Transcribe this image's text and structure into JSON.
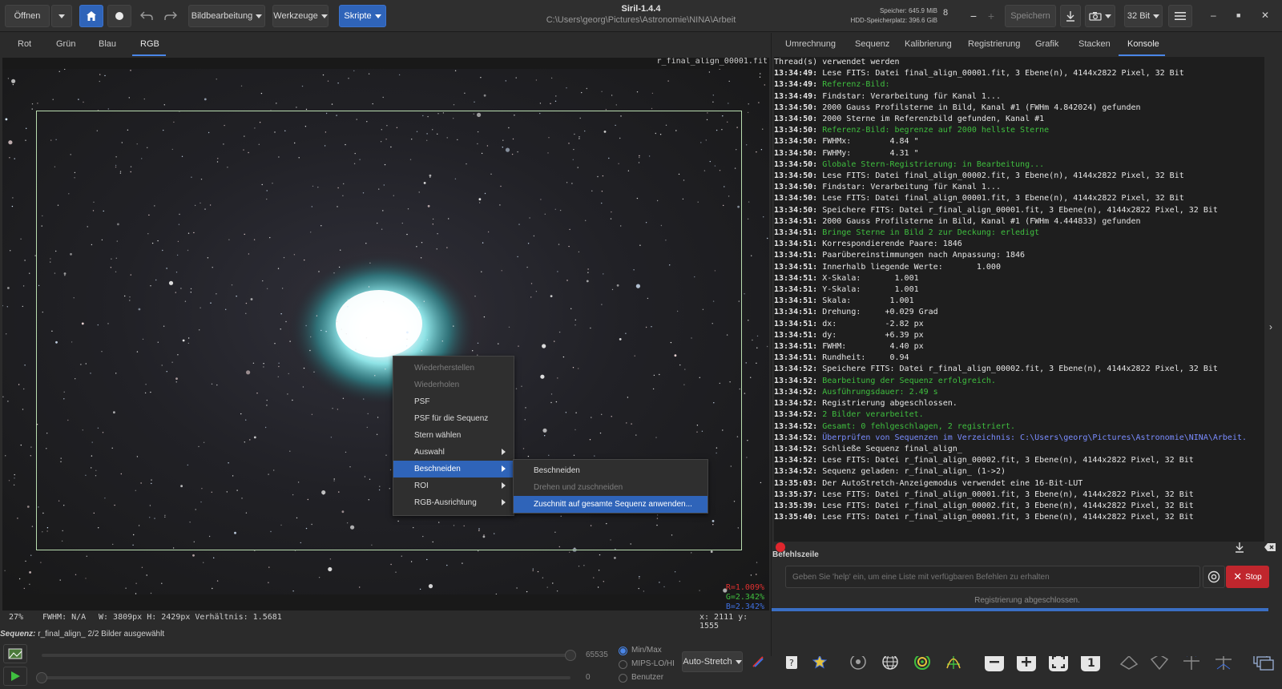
{
  "header": {
    "open_label": "Öffnen",
    "image_processing_label": "Bildbearbeitung",
    "tools_label": "Werkzeuge",
    "scripts_label": "Skripte",
    "app_title": "Siril-1.4.4",
    "app_path": "C:\\Users\\georg\\Pictures\\Astronomie\\NINA\\Arbeit",
    "memory_label": "Speicher: 645.9 MiB",
    "disk_label": "HDD-Speicherplatz: 396.6 GiB",
    "threads_value": "8",
    "save_label": "Speichern",
    "bitdepth_label": "32 Bit"
  },
  "channel_tabs": [
    {
      "label": "Rot"
    },
    {
      "label": "Grün"
    },
    {
      "label": "Blau"
    },
    {
      "label": "RGB"
    }
  ],
  "image": {
    "filename": "r_final_align_00001.fit",
    "stats": {
      "r": "R=1.009%",
      "g": "G=2.342%",
      "b": "B=2.342%"
    },
    "colors": {
      "r": "#e03030",
      "g": "#3fbf3f",
      "b": "#3f6fe0"
    }
  },
  "image_status": {
    "zoom": "27%",
    "fwhm": "FWHM: N/A",
    "dims": "W: 3809px H: 2429px Verhältnis: 1.5681",
    "coords": "x: 2111 y: 1555"
  },
  "sequence_status": {
    "prefix": "Sequenz:",
    "text": "r_final_align_ 2/2 Bilder ausgewählt"
  },
  "bottom": {
    "slider_max_value": "65535",
    "slider_min_value": "0",
    "radio_minmax": "Min/Max",
    "radio_mips": "MIPS-LO/HI",
    "radio_user": "Benutzer",
    "autostretch_label": "Auto-Stretch"
  },
  "right_tabs": [
    {
      "label": "Umrechnung"
    },
    {
      "label": "Sequenz"
    },
    {
      "label": "Kalibrierung"
    },
    {
      "label": "Registrierung"
    },
    {
      "label": "Grafik"
    },
    {
      "label": "Stacken"
    },
    {
      "label": "Konsole"
    }
  ],
  "console": {
    "lines": [
      {
        "t": "",
        "m": "Thread(s) verwendet werden",
        "c": "n"
      },
      {
        "t": "13:34:49:",
        "m": " Lese FITS: Datei final_align_00001.fit, 3 Ebene(n), 4144x2822 Pixel, 32 Bit",
        "c": "n"
      },
      {
        "t": "13:34:49:",
        "m": " Referenz-Bild:",
        "c": "g"
      },
      {
        "t": "13:34:49:",
        "m": " Findstar: Verarbeitung für Kanal 1...",
        "c": "n"
      },
      {
        "t": "13:34:50:",
        "m": " 2000 Gauss Profilsterne in Bild, Kanal #1 (FWHm 4.842024) gefunden",
        "c": "n"
      },
      {
        "t": "13:34:50:",
        "m": " 2000 Sterne im Referenzbild gefunden, Kanal #1",
        "c": "n"
      },
      {
        "t": "13:34:50:",
        "m": " Referenz-Bild: begrenze auf 2000 hellste Sterne",
        "c": "g"
      },
      {
        "t": "13:34:50:",
        "m": " FWHMx:        4.84 \"",
        "c": "n"
      },
      {
        "t": "13:34:50:",
        "m": " FWHMy:        4.31 \"",
        "c": "n"
      },
      {
        "t": "13:34:50:",
        "m": " Globale Stern-Registrierung: in Bearbeitung...",
        "c": "g"
      },
      {
        "t": "13:34:50:",
        "m": " Lese FITS: Datei final_align_00002.fit, 3 Ebene(n), 4144x2822 Pixel, 32 Bit",
        "c": "n"
      },
      {
        "t": "13:34:50:",
        "m": " Findstar: Verarbeitung für Kanal 1...",
        "c": "n"
      },
      {
        "t": "13:34:50:",
        "m": " Lese FITS: Datei final_align_00001.fit, 3 Ebene(n), 4144x2822 Pixel, 32 Bit",
        "c": "n"
      },
      {
        "t": "13:34:50:",
        "m": " Speichere FITS: Datei r_final_align_00001.fit, 3 Ebene(n), 4144x2822 Pixel, 32 Bit",
        "c": "n"
      },
      {
        "t": "13:34:51:",
        "m": " 2000 Gauss Profilsterne in Bild, Kanal #1 (FWHm 4.444833) gefunden",
        "c": "n"
      },
      {
        "t": "13:34:51:",
        "m": " Bringe Sterne in Bild 2 zur Deckung: erledigt",
        "c": "g"
      },
      {
        "t": "13:34:51:",
        "m": " Korrespondierende Paare: 1846",
        "c": "n"
      },
      {
        "t": "13:34:51:",
        "m": " Paarübereinstimmungen nach Anpassung: 1846",
        "c": "n"
      },
      {
        "t": "13:34:51:",
        "m": " Innerhalb liegende Werte:       1.000",
        "c": "n"
      },
      {
        "t": "13:34:51:",
        "m": " X-Skala:       1.001",
        "c": "n"
      },
      {
        "t": "13:34:51:",
        "m": " Y-Skala:       1.001",
        "c": "n"
      },
      {
        "t": "13:34:51:",
        "m": " Skala:        1.001",
        "c": "n"
      },
      {
        "t": "13:34:51:",
        "m": " Drehung:     +0.029 Grad",
        "c": "n"
      },
      {
        "t": "13:34:51:",
        "m": " dx:          -2.82 px",
        "c": "n"
      },
      {
        "t": "13:34:51:",
        "m": " dy:          +6.39 px",
        "c": "n"
      },
      {
        "t": "13:34:51:",
        "m": " FWHM:         4.40 px",
        "c": "n"
      },
      {
        "t": "13:34:51:",
        "m": " Rundheit:     0.94",
        "c": "n"
      },
      {
        "t": "13:34:52:",
        "m": " Speichere FITS: Datei r_final_align_00002.fit, 3 Ebene(n), 4144x2822 Pixel, 32 Bit",
        "c": "n"
      },
      {
        "t": "13:34:52:",
        "m": " Bearbeitung der Sequenz erfolgreich.",
        "c": "g"
      },
      {
        "t": "13:34:52:",
        "m": " Ausführungsdauer: 2.49 s",
        "c": "g"
      },
      {
        "t": "13:34:52:",
        "m": " Registrierung abgeschlossen.",
        "c": "n"
      },
      {
        "t": "13:34:52:",
        "m": " 2 Bilder verarbeitet.",
        "c": "g"
      },
      {
        "t": "13:34:52:",
        "m": " Gesamt: 0 fehlgeschlagen, 2 registriert.",
        "c": "g"
      },
      {
        "t": "13:34:52:",
        "m": " Überprüfen von Sequenzen im Verzeichnis: C:\\Users\\georg\\Pictures\\Astronomie\\NINA\\Arbeit.",
        "c": "b"
      },
      {
        "t": "13:34:52:",
        "m": " Schließe Sequenz final_align_",
        "c": "n"
      },
      {
        "t": "13:34:52:",
        "m": " Lese FITS: Datei r_final_align_00002.fit, 3 Ebene(n), 4144x2822 Pixel, 32 Bit",
        "c": "n"
      },
      {
        "t": "13:34:52:",
        "m": " Sequenz geladen: r_final_align_ (1->2)",
        "c": "n"
      },
      {
        "t": "13:35:03:",
        "m": " Der AutoStretch-Anzeigemodus verwendet eine 16-Bit-LUT",
        "c": "n"
      },
      {
        "t": "13:35:37:",
        "m": " Lese FITS: Datei r_final_align_00001.fit, 3 Ebene(n), 4144x2822 Pixel, 32 Bit",
        "c": "n"
      },
      {
        "t": "13:35:39:",
        "m": " Lese FITS: Datei r_final_align_00002.fit, 3 Ebene(n), 4144x2822 Pixel, 32 Bit",
        "c": "n"
      },
      {
        "t": "13:35:40:",
        "m": " Lese FITS: Datei r_final_align_00001.fit, 3 Ebene(n), 4144x2822 Pixel, 32 Bit",
        "c": "n"
      }
    ],
    "command_label": "Befehlszeile",
    "command_placeholder": "Geben Sie 'help' ein, um eine Liste mit verfügbaren Befehlen zu erhalten",
    "stop_label": "Stop",
    "status_text": "Registrierung abgeschlossen."
  },
  "context_menu": {
    "items": [
      {
        "label": "Wiederherstellen",
        "state": "disabled"
      },
      {
        "label": "Wiederholen",
        "state": "disabled"
      },
      {
        "label": "PSF",
        "state": "normal"
      },
      {
        "label": "PSF für die Sequenz",
        "state": "normal"
      },
      {
        "label": "Stern wählen",
        "state": "normal"
      },
      {
        "label": "Auswahl",
        "state": "normal",
        "submenu": true
      },
      {
        "label": "Beschneiden",
        "state": "selected",
        "submenu": true
      },
      {
        "label": "ROI",
        "state": "normal",
        "submenu": true
      },
      {
        "label": "RGB-Ausrichtung",
        "state": "normal",
        "submenu": true
      }
    ],
    "submenu": [
      {
        "label": "Beschneiden",
        "state": "normal"
      },
      {
        "label": "Drehen und zuschneiden",
        "state": "disabled"
      },
      {
        "label": "Zuschnitt auf gesamte Sequenz anwenden...",
        "state": "selected"
      }
    ]
  },
  "colors": {
    "accent": "#2f64b9",
    "stop": "#c0262d",
    "log_green": "#3fbf3f",
    "log_blue": "#7a8cff"
  }
}
